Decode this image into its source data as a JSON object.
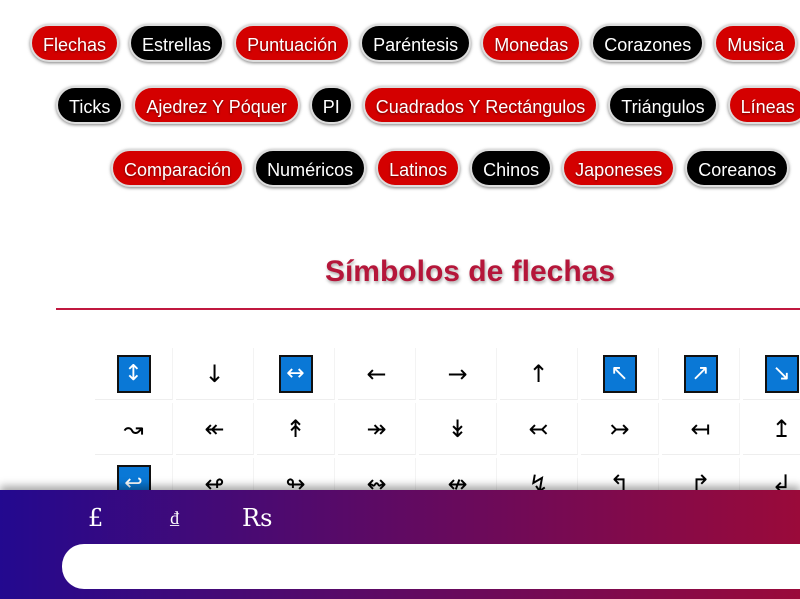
{
  "categories": {
    "row1": [
      {
        "label": "Flechas",
        "color": "red"
      },
      {
        "label": "Estrellas",
        "color": "black"
      },
      {
        "label": "Puntuación",
        "color": "red"
      },
      {
        "label": "Paréntesis",
        "color": "black"
      },
      {
        "label": "Monedas",
        "color": "red"
      },
      {
        "label": "Corazones",
        "color": "black"
      },
      {
        "label": "Musica",
        "color": "red"
      }
    ],
    "row2": [
      {
        "label": "Ticks",
        "color": "black"
      },
      {
        "label": "Ajedrez Y Póquer",
        "color": "red"
      },
      {
        "label": "PI",
        "color": "black"
      },
      {
        "label": "Cuadrados Y Rectángulos",
        "color": "red"
      },
      {
        "label": "Triángulos",
        "color": "black"
      },
      {
        "label": "Líneas",
        "color": "red"
      }
    ],
    "row3": [
      {
        "label": "Comparación",
        "color": "red"
      },
      {
        "label": "Numéricos",
        "color": "black"
      },
      {
        "label": "Latinos",
        "color": "red"
      },
      {
        "label": "Chinos",
        "color": "black"
      },
      {
        "label": "Japoneses",
        "color": "red"
      },
      {
        "label": "Coreanos",
        "color": "black"
      }
    ]
  },
  "section_title": "Símbolos de flechas",
  "symbols": [
    {
      "char": "↕",
      "boxed": true
    },
    {
      "char": "↓",
      "boxed": false
    },
    {
      "char": "↔",
      "boxed": true
    },
    {
      "char": "←",
      "boxed": false
    },
    {
      "char": "→",
      "boxed": false
    },
    {
      "char": "↑",
      "boxed": false
    },
    {
      "char": "↖",
      "boxed": true
    },
    {
      "char": "↗",
      "boxed": true
    },
    {
      "char": "↘",
      "boxed": true
    },
    {
      "char": "↝",
      "boxed": false
    },
    {
      "char": "↞",
      "boxed": false
    },
    {
      "char": "↟",
      "boxed": false
    },
    {
      "char": "↠",
      "boxed": false
    },
    {
      "char": "↡",
      "boxed": false
    },
    {
      "char": "↢",
      "boxed": false
    },
    {
      "char": "↣",
      "boxed": false
    },
    {
      "char": "↤",
      "boxed": false
    },
    {
      "char": "↥",
      "boxed": false
    },
    {
      "char": "↩",
      "boxed": true
    },
    {
      "char": "↫",
      "boxed": false
    },
    {
      "char": "↬",
      "boxed": false
    },
    {
      "char": "↭",
      "boxed": false
    },
    {
      "char": "↮",
      "boxed": false
    },
    {
      "char": "↯",
      "boxed": false
    },
    {
      "char": "↰",
      "boxed": false
    },
    {
      "char": "↱",
      "boxed": false
    },
    {
      "char": "↲",
      "boxed": false
    }
  ],
  "selected_bar": {
    "symbols": [
      "£",
      "₫",
      "Rs"
    ],
    "input_value": ""
  },
  "colors": {
    "red": "#d40000",
    "black": "#000000",
    "title": "#b5163a",
    "box": "#0a78d6"
  }
}
